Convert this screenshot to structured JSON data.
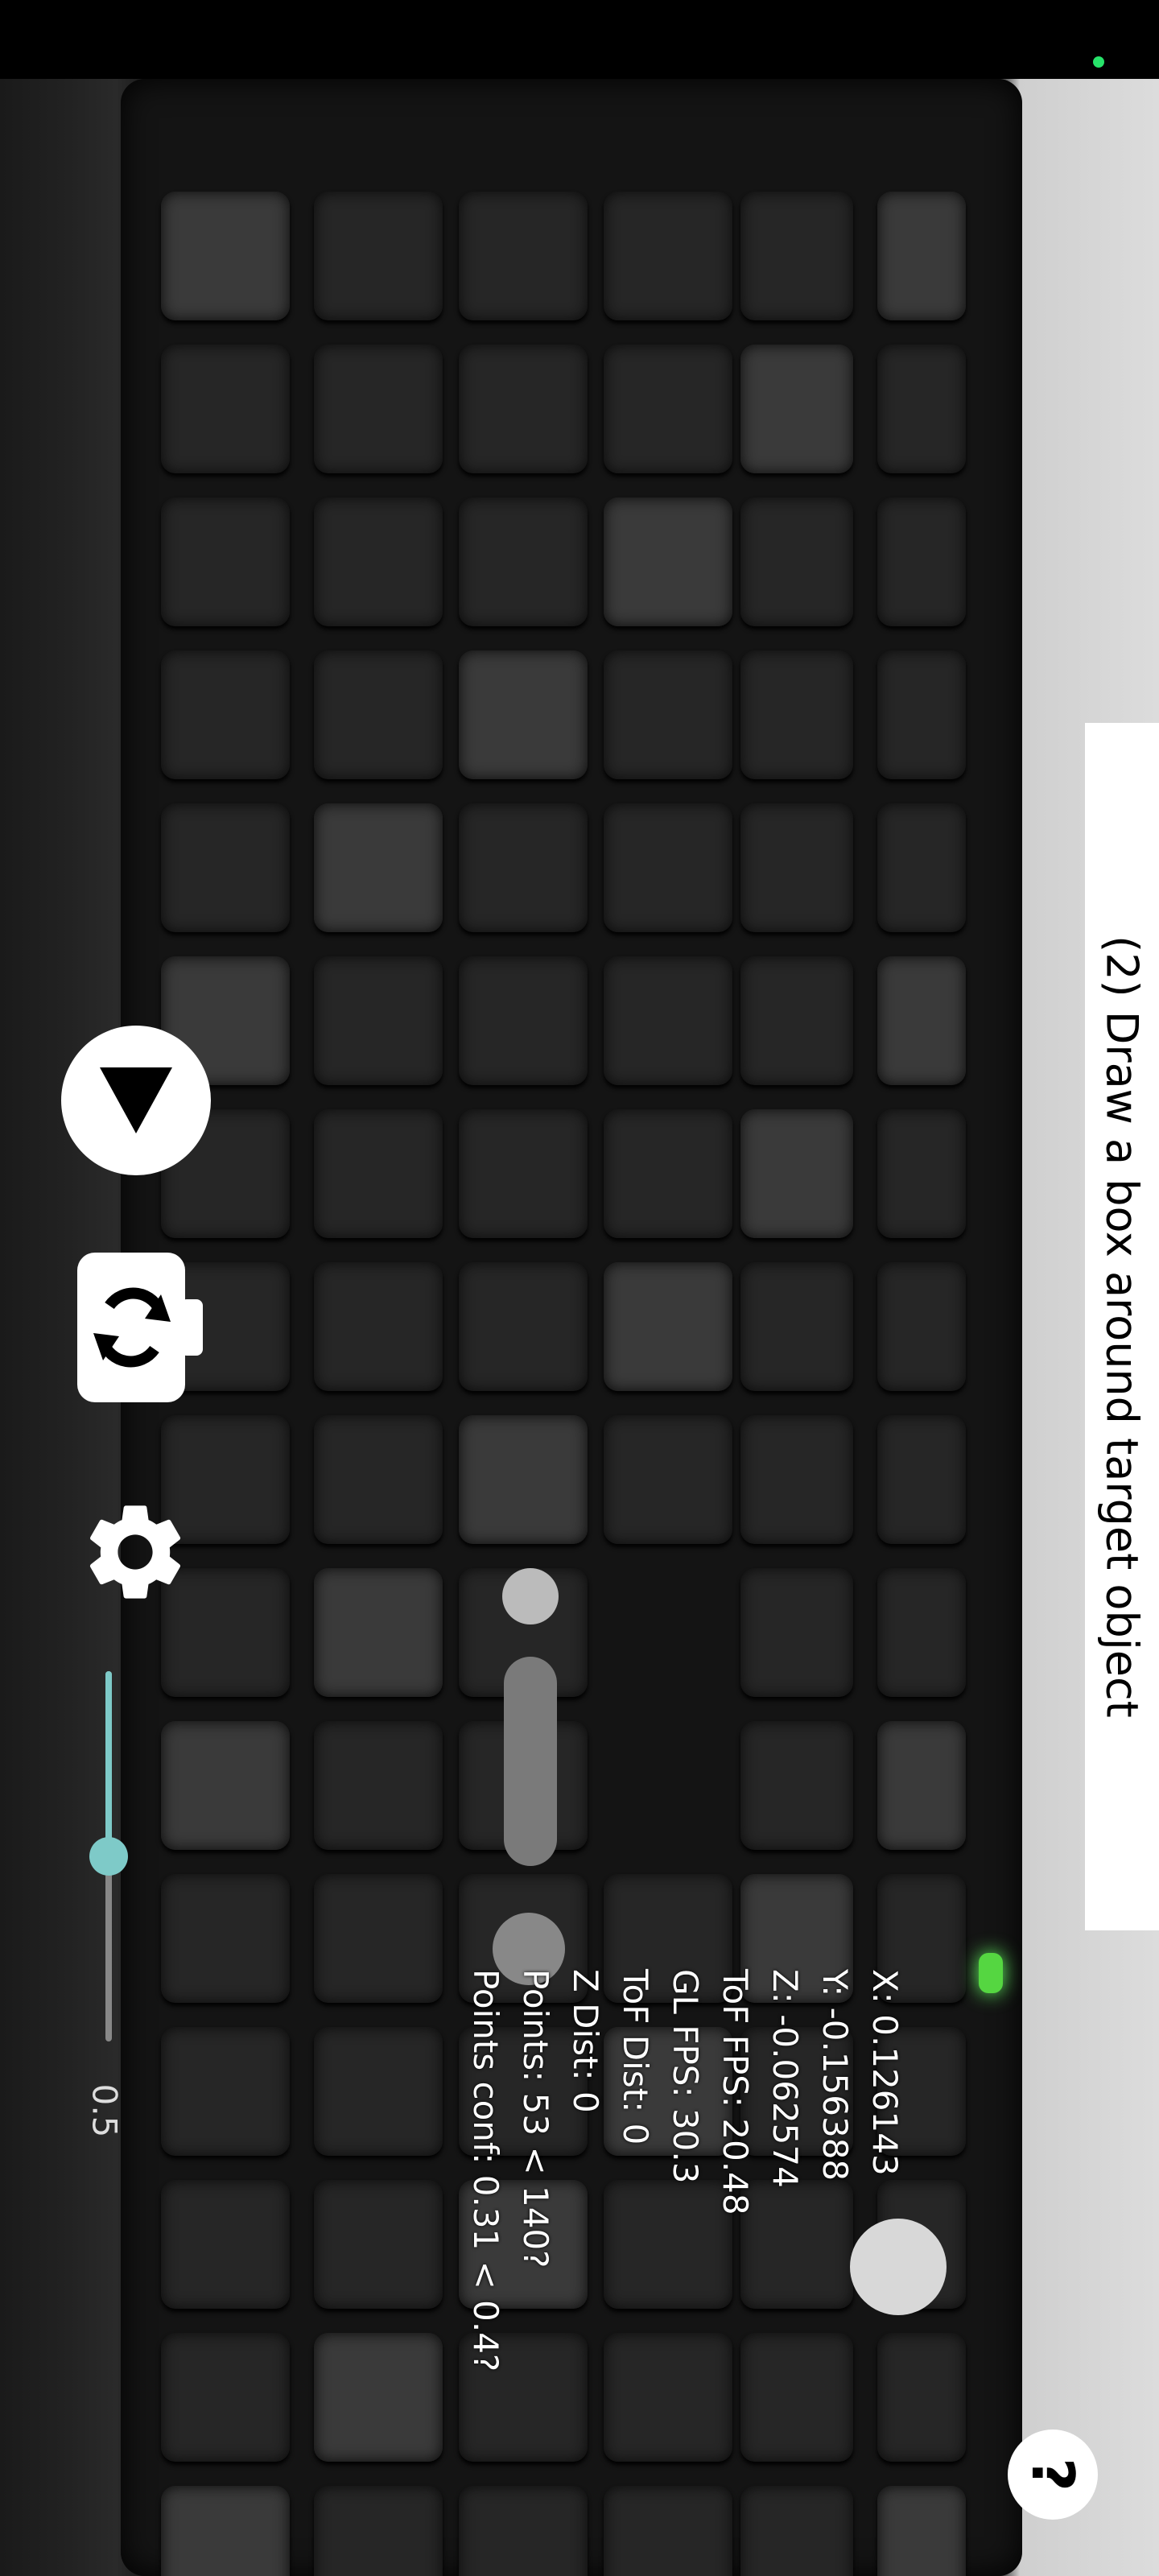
{
  "colors": {
    "accent": "#7ECAC8",
    "status_dot": "#27E36A"
  },
  "instruction": {
    "text": "(2) Draw a box around target object"
  },
  "controls": {
    "play_icon": "play-icon",
    "camera_switch_icon": "camera-switch-icon",
    "settings_icon": "gear-icon",
    "help_label": "?"
  },
  "slider": {
    "value_label": "0.5",
    "level": 0.5
  },
  "stats": {
    "x": "X: 0.126143",
    "y": "Y: -0.156388",
    "z": "Z: -0.062574",
    "tof_fps": "ToF FPS: 20.48",
    "gl_fps": "GL FPS: 30.3",
    "tof_dist": "ToF Dist: 0",
    "z_dist": "Z Dist: 0",
    "points": "Points: 53 < 140?",
    "points_conf": "Points conf: 0.31 < 0.4?"
  }
}
